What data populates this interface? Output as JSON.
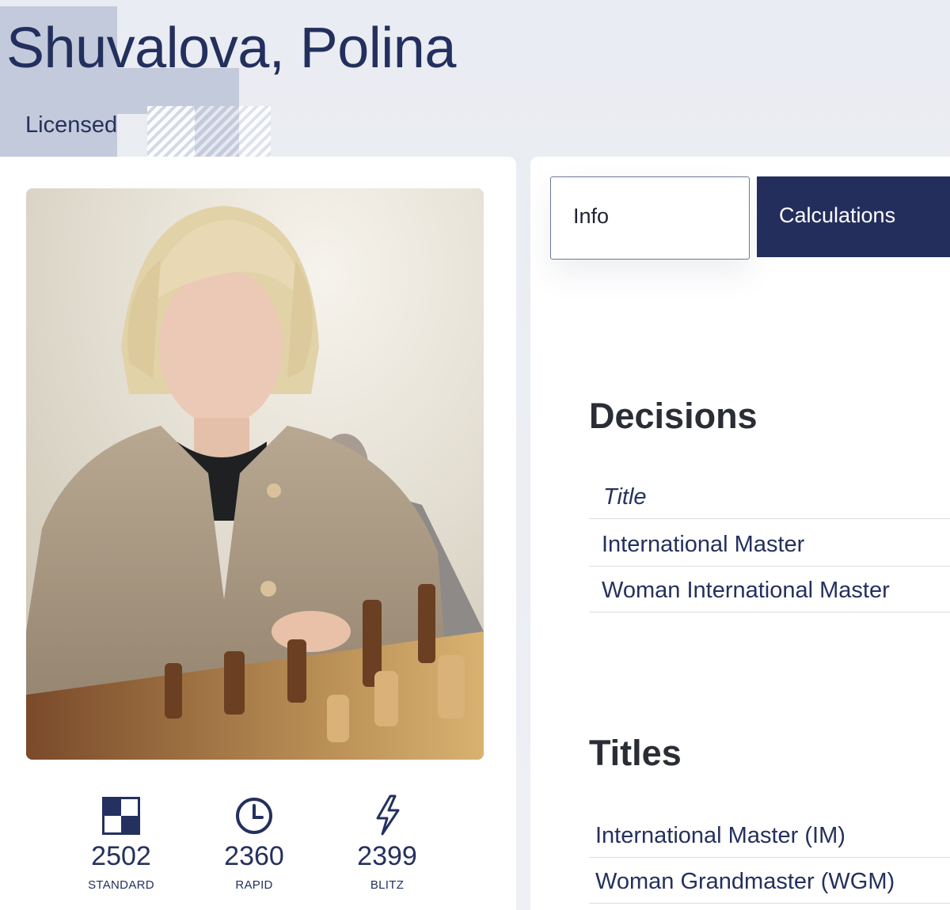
{
  "profile": {
    "name": "Shuvalova, Polina",
    "status": "Licensed",
    "photo_alt": "Player photo"
  },
  "ratings": [
    {
      "icon": "standard-icon",
      "value": "2502",
      "label": "STANDARD"
    },
    {
      "icon": "rapid-clock-icon",
      "value": "2360",
      "label": "RAPID"
    },
    {
      "icon": "blitz-lightning-icon",
      "value": "2399",
      "label": "BLITZ"
    }
  ],
  "tabs": {
    "info": "Info",
    "calculations": "Calculations",
    "active": "calculations"
  },
  "decisions": {
    "heading": "Decisions",
    "column_header": "Title",
    "rows": [
      "International Master",
      "Woman International Master"
    ]
  },
  "titles": {
    "heading": "Titles",
    "rows": [
      "International Master (IM)",
      "Woman Grandmaster (WGM)"
    ]
  },
  "colors": {
    "brand_navy": "#242e5c",
    "text_navy": "#24305e",
    "background": "#eceef3",
    "deco_blue": "#c3cadb"
  }
}
